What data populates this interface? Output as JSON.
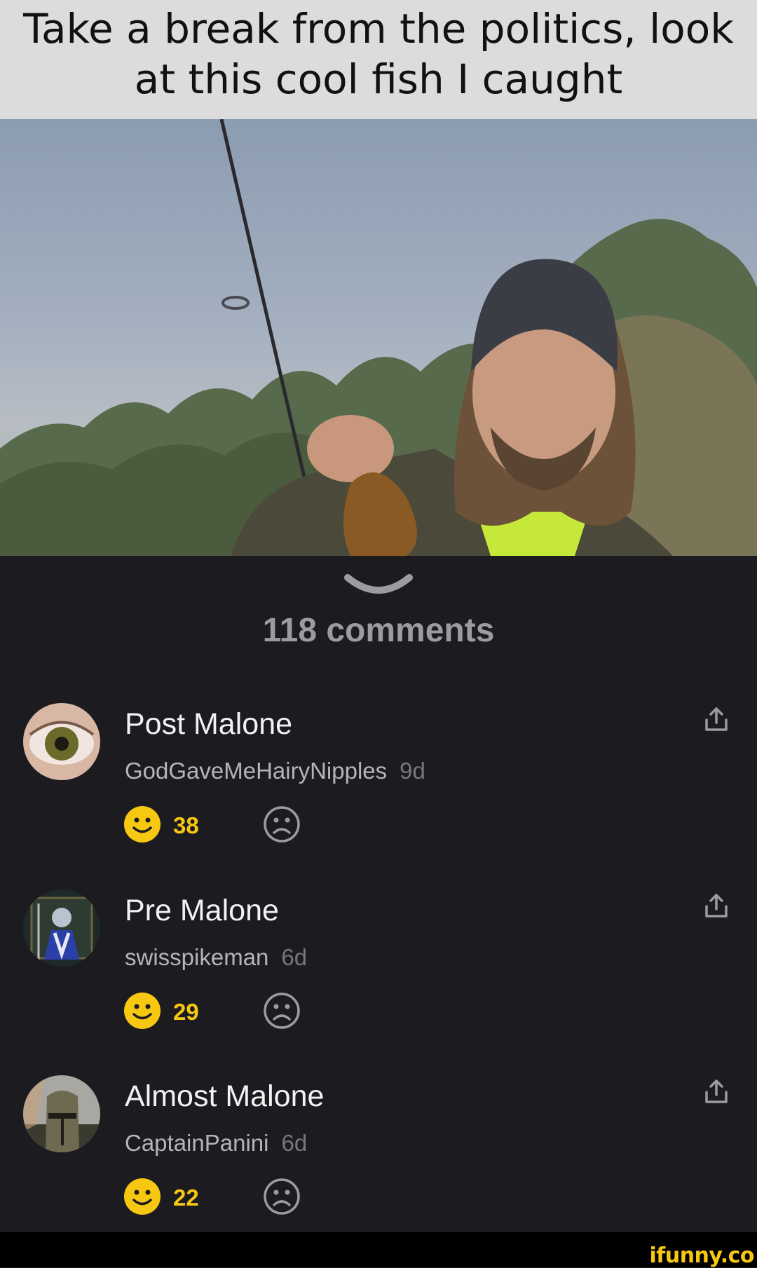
{
  "meme": {
    "caption": "Take a break from the politics, look at this cool fish I caught"
  },
  "comments_header": {
    "count_label": "118 comments"
  },
  "comments": [
    {
      "name": "Post Malone",
      "user": "GodGaveMeHairyNipples",
      "time": "9d",
      "votes": "38"
    },
    {
      "name": "Pre Malone",
      "user": "swisspikeman",
      "time": "6d",
      "votes": "29"
    },
    {
      "name": "Almost Malone",
      "user": "CaptainPanini",
      "time": "6d",
      "votes": "22"
    }
  ],
  "watermark": {
    "text": "ifunny.co"
  },
  "icons": [
    "chevron-down-icon",
    "share-icon",
    "smile-icon",
    "frown-icon"
  ],
  "colors": {
    "background": "#1c1b20",
    "accent_yellow": "#f7c812",
    "muted": "#78777e"
  }
}
